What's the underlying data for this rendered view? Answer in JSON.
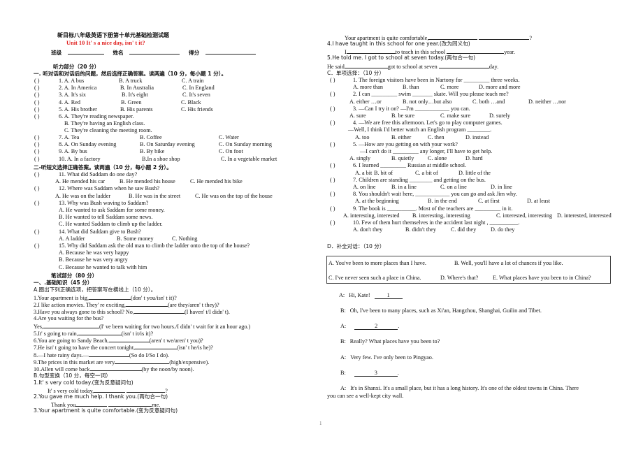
{
  "header": {
    "title_cn": "新目标八年级英语下册第十单元基础检测试题",
    "title_en": "Unit 10    It' s a nice day, isn' t it?",
    "class_label": "班级",
    "name_label": "姓名",
    "score_label": "得分",
    "accent_color": "#e0201f"
  },
  "listening": {
    "heading": "听力部分（20 分）",
    "part1": {
      "instruction": "一. 听对话和对话后的问题，然后选择正确答案。读两遍（10 分，每小题 1 分）。",
      "items": [
        {
          "num": "1. A. A bus",
          "b": "B. A truck",
          "c": "C. A train"
        },
        {
          "num": "2. A. In America",
          "b": "B. In Australia",
          "c": "C. In England"
        },
        {
          "num": "3. A. It's six",
          "b": "B. It's eight",
          "c": "C. It's seven"
        },
        {
          "num": "4. A. Red",
          "b": "B. Green",
          "c": "C. Black"
        },
        {
          "num": "5. A. His brother",
          "b": "B. His parents",
          "c": "C. His friends"
        },
        {
          "num": "6. A. They're reading newspaper.",
          "b": "B. They're having an English class.",
          "c": "C. They're cleaning the meeting room."
        },
        {
          "num": "7. A. Tea",
          "b": "B. Coffee",
          "c": "C. Water"
        },
        {
          "num": "8. A. On Sunday evening",
          "b": "B. On Saturday evening",
          "c": "C. On Sunday morning"
        },
        {
          "num": "9. A. By bus",
          "b": "B. By bike",
          "c": "C. On foot"
        },
        {
          "num": "10. A. In a factory",
          "b": "B.In a shoe shop",
          "c": "C. In a vegetable market"
        }
      ]
    },
    "part2": {
      "instruction": "二-听短文选择正确答案。读两遍（10 分，每小题 2 分）。",
      "items": [
        {
          "q": "11. What did Saddam do one day?",
          "opts": [
            "A. He mended his car",
            "B. He mended his house",
            "C. He mended his bike"
          ]
        },
        {
          "q": "12. Where was Saddam when he saw Bush?",
          "opts": [
            "A. He was on the ladder",
            "B. He was in the street",
            "C. He was on the top of the house"
          ]
        },
        {
          "q": "13. Why was Bush waving to Saddam?",
          "opts": [
            "A. He wanted to ask Saddam for some money.",
            "B. He wanted to tell Saddam some news.",
            "C. He wanted Saddam to climb up the ladder."
          ]
        },
        {
          "q": "14. What did Saddam give to Bush?",
          "opts": [
            "A. A ladder",
            "B. Some money",
            "C. Nothing"
          ]
        },
        {
          "q": "15. Why did Saddam ask the old man to climb the ladder onto the top of the house?",
          "opts": [
            "A. Because he was very happy",
            "B. Because he was very angry",
            "C. Because he wanted to talk with him"
          ]
        }
      ]
    }
  },
  "written": {
    "heading": "笔试部分（80 分）",
    "basics_heading": "一、.基础知识（45 分）",
    "sectionA": {
      "instruction": "A.圈出下列正确选项，把答案写在横线上（10 分）。",
      "items": [
        {
          "pre": "1.Your apartment is big,",
          "post": "(don' t you/isn' t it)?"
        },
        {
          "pre": "2.I like action movies. They' re exciting,",
          "post": "(are they/aren' t they)?"
        },
        {
          "pre": "3.Have you always gone to this school? No,",
          "post": "(I haven' t/I didn' t)."
        },
        {
          "pre": "4.Are you waiting for the bus?",
          "post": ""
        },
        {
          "pre": "Yes,",
          "post": "(I' ve been waiting for two hours./I didn' t wait for it an hour ago.)"
        },
        {
          "pre": "5.It' s going to rain,",
          "post": "(isn' t it/is it)?"
        },
        {
          "pre": "6.You are going to Sandy Beach,",
          "post": "(aren' t we/aren' t you)?"
        },
        {
          "pre": "7.He isn' t going to have the concert tonight,",
          "post": "(isn' t he/is he)?"
        },
        {
          "pre": "8.—I hate rainy days.—",
          "post": "(So do I/So I do)."
        },
        {
          "pre": "9.The prices in this market are very",
          "post": "(high/expensive)."
        },
        {
          "pre": "10.Allen will come back",
          "post": "(by the noon/by noon)."
        }
      ]
    },
    "sectionB": {
      "instruction": "B.句型变换（10 分，每空一词）",
      "items": [
        {
          "prompt": "1.It' s very cold today.(变为反意疑问句)",
          "answer_pre": "It' s very cold today,",
          "answer_mid": "",
          "answer_post": "?"
        },
        {
          "prompt": "2.You gave me much help. I thank you.(两句合一句)",
          "answer_pre": "Thank you",
          "answer_mid": "",
          "answer_post": "me."
        },
        {
          "prompt": "3.Your apartment is quite comfortable.(变为反意疑问句)",
          "answer_pre": "Your apartment is quite comfortable,",
          "answer_mid": "",
          "answer_post": "?"
        },
        {
          "prompt": "4.I have taught in this school for one year.(改为同义句)",
          "answer_pre": "I",
          "answer_mid": "to teach in this school",
          "answer_post": "year."
        },
        {
          "prompt": "5.He told me. I got to school at seven today.(两句合一句)",
          "answer_pre": "He said",
          "answer_mid": "got to school at seven",
          "answer_post": "day."
        }
      ]
    },
    "sectionC": {
      "instruction": "C．单项选择：（10 分）",
      "items": [
        {
          "q": "1. The foreign visitors have been in Nartony for _________ three weeks.",
          "opts": [
            "A. more than",
            "B. than",
            "C. more",
            "D. more and more"
          ]
        },
        {
          "q": "2. I can _________ swim _______ skate. Will you please teach me?",
          "opts": [
            "A. either …or",
            "B. not only…but also",
            "C. both …and",
            "D. neither …nor"
          ]
        },
        {
          "q": "3.  —Can I try it on?  —I'm ____________ you can.",
          "opts": [
            "A. sure",
            "B. be sure",
            "C. make sure",
            "D. surely"
          ]
        },
        {
          "q": "4.  —We are free this afternoon. Let's go to play computer games.",
          "q2": "—Well, I think I'd better watch an English program ________.",
          "opts": [
            "A. too",
            "B. either",
            "C. then",
            "D. instead"
          ]
        },
        {
          "q": "5.  —How are you getting on with your work?",
          "q2": "—I can't do it _________ any longer, I'll have to get help.",
          "opts": [
            "A. singly",
            "B. quietly",
            "C. alone",
            "D. hard"
          ]
        },
        {
          "q": "6. I learned _________ Russian at middle school.",
          "opts": [
            "A. a bit",
            "B. bit of",
            "C. a bit of",
            "D. little of the"
          ]
        },
        {
          "q": "7. Children are standing ________ and getting on the bus.",
          "opts": [
            "A. on line",
            "B. in a line",
            "C. on a line",
            "D. in line"
          ]
        },
        {
          "q": "8. You shouldn't wait here, ____________ you can go and ask Jim why.",
          "opts": [
            "A. at the beginning",
            "B. in the end",
            "C. at first",
            "D. at least"
          ]
        },
        {
          "q": "9. The book is __________. Most of the teachers are _________ in it.",
          "opts": [
            "A. interesting, interested",
            "B. interesting, interesting",
            "C. interested, interesting",
            "D. interested, interested"
          ]
        },
        {
          "q": "10. Few of them hurt themselves in the accident last night , __________.",
          "opts": [
            "A. don't they",
            "B. didn't they",
            "C. did they",
            "D. do they"
          ]
        }
      ]
    },
    "sectionD": {
      "instruction": "D．补全对话：（10 分）",
      "box": [
        [
          "A. You've been to more places than I have.",
          "B. Well, you'll have a lot of chances if you like."
        ],
        [
          "C. I've never seen such a place in China.",
          "D. Where's that?",
          "E. What places have you been to in China?"
        ]
      ],
      "dialogue": [
        {
          "speaker": "A:",
          "text": "Hi, Kate!",
          "blank": "1"
        },
        {
          "speaker": "B:",
          "text": "Oh, I've been to many places, such as Xi'an, Hangzhou, Shanghai, Guilin and Tibet.",
          "blank": ""
        },
        {
          "speaker": "A:",
          "text": "",
          "blank": "2"
        },
        {
          "speaker": "B:",
          "text": "Really? What places have you been to?",
          "blank": ""
        },
        {
          "speaker": "A:",
          "text": "Very few. I've only been to Pingyao.",
          "blank": ""
        },
        {
          "speaker": "B:",
          "text": "",
          "blank": "3"
        },
        {
          "speaker": "A:",
          "text": "It's in Shanxi. It's a small place, but it has a long history. It's one of the oldest towns in China. There",
          "blank": ""
        }
      ],
      "dialogue_continuation": "you can see a well-kept city wall."
    }
  },
  "footer": {
    "page_number": "1"
  }
}
